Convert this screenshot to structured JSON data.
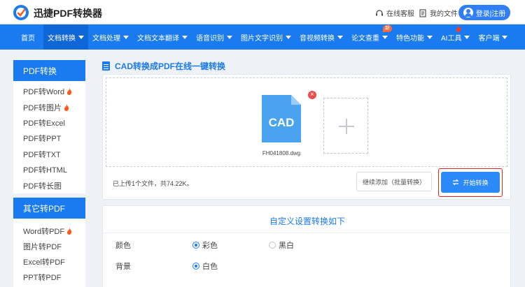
{
  "header": {
    "brand": "迅捷PDF转换器",
    "service": "在线客服",
    "my_files": "我的文件",
    "login": "登录|注册"
  },
  "nav": {
    "items": [
      {
        "label": "首页",
        "caret": false
      },
      {
        "label": "文档转换",
        "caret": true,
        "active": true
      },
      {
        "label": "文档处理",
        "caret": true
      },
      {
        "label": "文档文本翻译",
        "caret": true
      },
      {
        "label": "语音识别",
        "caret": true
      },
      {
        "label": "图片文字识别",
        "caret": true
      },
      {
        "label": "音视频转换",
        "caret": true
      },
      {
        "label": "论文查重",
        "caret": true,
        "badge": "新"
      },
      {
        "label": "特色功能",
        "caret": true
      },
      {
        "label": "AI工具",
        "caret": true,
        "hot": true
      },
      {
        "label": "客户端",
        "caret": true
      }
    ]
  },
  "sidebar": {
    "group1": {
      "title": "PDF转换",
      "items": [
        {
          "label": "PDF转Word",
          "hot": true
        },
        {
          "label": "PDF转图片",
          "hot": true
        },
        {
          "label": "PDF转Excel"
        },
        {
          "label": "PDF转PPT"
        },
        {
          "label": "PDF转TXT"
        },
        {
          "label": "PDF转HTML"
        },
        {
          "label": "PDF转长图"
        }
      ]
    },
    "group2": {
      "title": "其它转PDF",
      "items": [
        {
          "label": "Word转PDF",
          "hot": true
        },
        {
          "label": "图片转PDF"
        },
        {
          "label": "Excel转PDF"
        },
        {
          "label": "PPT转PDF"
        }
      ]
    }
  },
  "main": {
    "title": "CAD转换成PDF在线一键转换",
    "file": {
      "type_label": "CAD",
      "name": "FH041808.dwg"
    },
    "status": "已上传1个文件，共74.22K。",
    "add_more": "继续添加（批量转换）",
    "start": "开始转换"
  },
  "settings": {
    "title": "自定义设置转换如下",
    "color_label": "颜色",
    "color_options": [
      "彩色",
      "黑白"
    ],
    "color_selected": "彩色",
    "bg_label": "背景",
    "bg_options": [
      "白色"
    ],
    "bg_selected": "白色"
  },
  "colors": {
    "brand_blue": "#1a7bf0",
    "hot_flame": "#ff5a1f",
    "remove_red": "#f04b4b",
    "highlight_red": "#e0251d",
    "cad_file_blue": "#4aa3f0"
  }
}
